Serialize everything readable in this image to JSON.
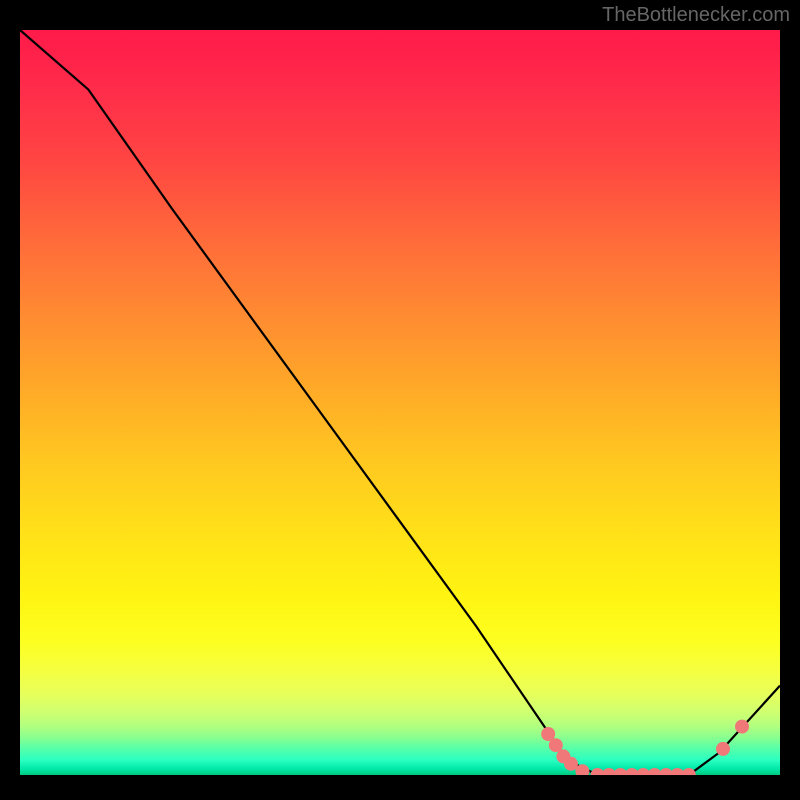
{
  "attribution": "TheBottlenecker.com",
  "chart_data": {
    "type": "line",
    "title": "",
    "xlabel": "",
    "ylabel": "",
    "xlim": [
      0,
      100
    ],
    "ylim": [
      0,
      100
    ],
    "curve": [
      {
        "x": 0,
        "y": 100
      },
      {
        "x": 9,
        "y": 92
      },
      {
        "x": 20,
        "y": 76
      },
      {
        "x": 30,
        "y": 62
      },
      {
        "x": 40,
        "y": 48
      },
      {
        "x": 50,
        "y": 34
      },
      {
        "x": 60,
        "y": 20
      },
      {
        "x": 68,
        "y": 8
      },
      {
        "x": 72,
        "y": 2
      },
      {
        "x": 76,
        "y": 0
      },
      {
        "x": 82,
        "y": 0
      },
      {
        "x": 88,
        "y": 0
      },
      {
        "x": 92,
        "y": 3
      },
      {
        "x": 100,
        "y": 12
      }
    ],
    "markers": [
      {
        "x": 69.5,
        "y": 5.5
      },
      {
        "x": 70.5,
        "y": 4.0
      },
      {
        "x": 71.5,
        "y": 2.5
      },
      {
        "x": 72.5,
        "y": 1.5
      },
      {
        "x": 74.0,
        "y": 0.5
      },
      {
        "x": 76.0,
        "y": 0.0
      },
      {
        "x": 77.5,
        "y": 0.0
      },
      {
        "x": 79.0,
        "y": 0.0
      },
      {
        "x": 80.5,
        "y": 0.0
      },
      {
        "x": 82.0,
        "y": 0.0
      },
      {
        "x": 83.5,
        "y": 0.0
      },
      {
        "x": 85.0,
        "y": 0.0
      },
      {
        "x": 86.5,
        "y": 0.0
      },
      {
        "x": 88.0,
        "y": 0.0
      },
      {
        "x": 92.5,
        "y": 3.5
      },
      {
        "x": 95.0,
        "y": 6.5
      }
    ],
    "marker_color": "#f07878",
    "line_color": "#000000"
  }
}
